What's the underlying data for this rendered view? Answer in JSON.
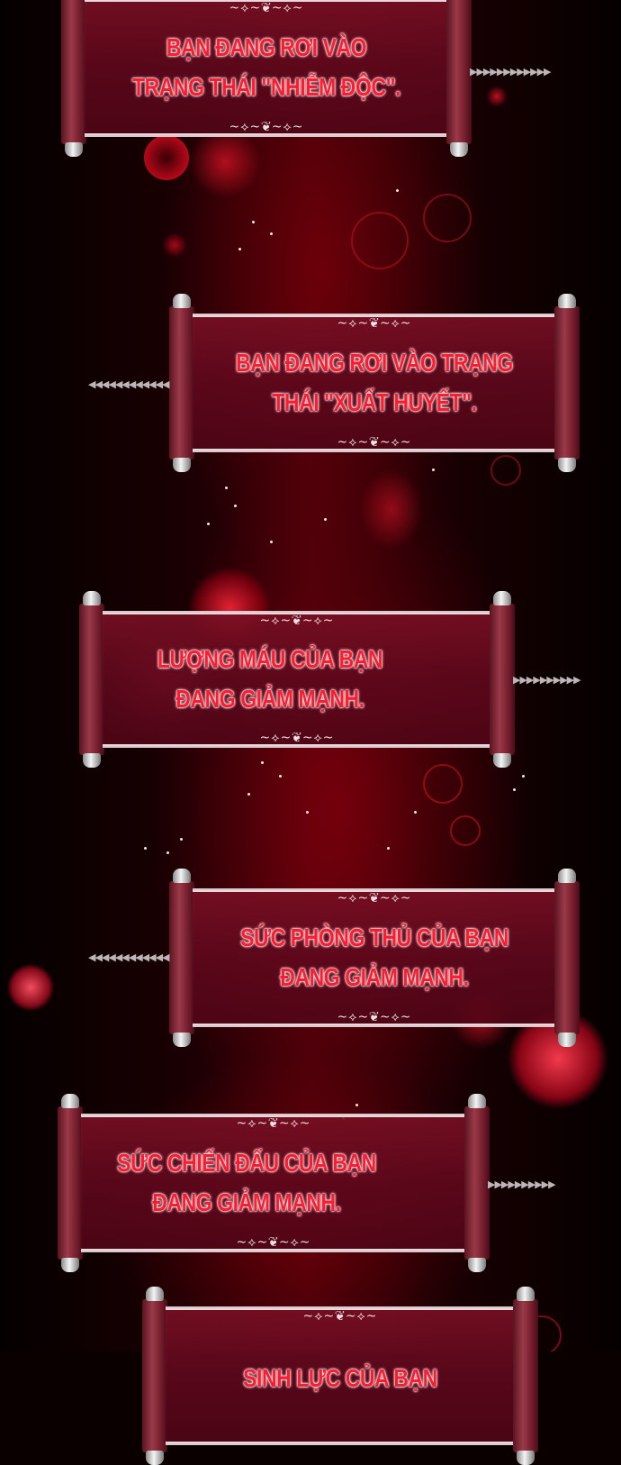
{
  "notifications": [
    {
      "line1": "BẠN ĐANG RƠI VÀO",
      "line2": "TRẠNG THÁI \"NHIỄM ĐỘC\"."
    },
    {
      "line1": "BẠN ĐANG RƠI VÀO TRẠNG",
      "line2": "THÁI \"XUẤT HUYẾT\"."
    },
    {
      "line1": "LƯỢNG MÁU CỦA BẠN",
      "line2": "ĐANG GIẢM MẠNH."
    },
    {
      "line1": "SỨC PHÒNG THỦ CỦA BẠN",
      "line2": "ĐANG GIẢM MẠNH."
    },
    {
      "line1": "SỨC CHIẾN ĐẤU CỦA BẠN",
      "line2": "ĐANG GIẢM MẠNH."
    },
    {
      "line1": "SINH LỰC CỦA BẠN",
      "line2": ""
    }
  ],
  "colors": {
    "text": "#ff1a2e",
    "scroll": "#7a0f25",
    "background": "#0a0000"
  },
  "icons": {
    "ornament": "flourish-icon",
    "chain": "chain-link-icon"
  }
}
